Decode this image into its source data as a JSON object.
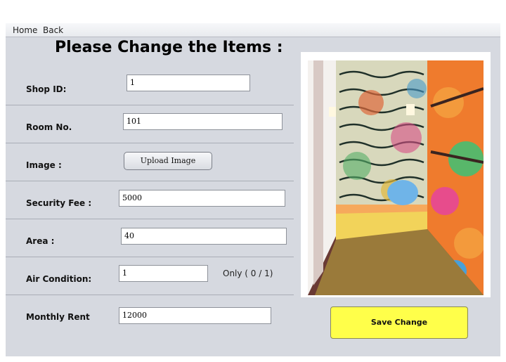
{
  "menu": {
    "home": "Home",
    "back": "Back"
  },
  "form": {
    "title": "Please Change the Items :",
    "shop_id": {
      "label": "Shop ID:",
      "value": "1"
    },
    "room_no": {
      "label": "Room No.",
      "value": "101"
    },
    "image": {
      "label": "Image :",
      "button": "Upload Image"
    },
    "security_fee": {
      "label": "Security Fee :",
      "value": "5000"
    },
    "area": {
      "label": "Area :",
      "value": "40"
    },
    "air_condition": {
      "label": "Air Condition:",
      "value": "1",
      "hint": "Only  ( 0 / 1)"
    },
    "monthly_rent": {
      "label": "Monthly Rent",
      "value": "12000"
    }
  },
  "save_button": "Save Change",
  "colors": {
    "panel": "#d6d9e0",
    "save_button": "#ffff4a"
  }
}
